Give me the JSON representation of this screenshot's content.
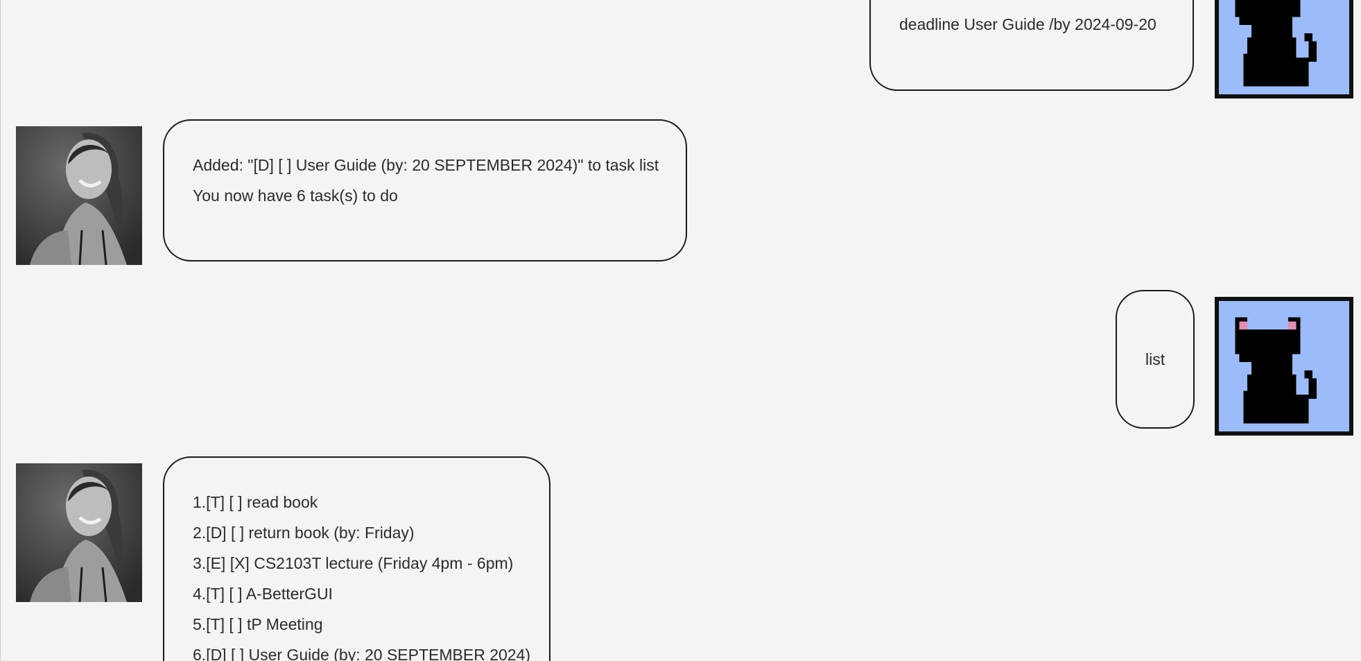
{
  "window": {
    "background": "#f4f4f4"
  },
  "messages": [
    {
      "sender": "user",
      "lines": [
        "deadline User Guide /by 2024-09-20"
      ]
    },
    {
      "sender": "bot",
      "lines": [
        "Added: \"[D] [ ] User Guide (by: 20 SEPTEMBER 2024)\" to task list",
        "You now have 6 task(s) to do"
      ]
    },
    {
      "sender": "user",
      "lines": [
        "list"
      ]
    },
    {
      "sender": "bot",
      "lines": [
        "1.[T] [ ] read book",
        "2.[D] [ ] return book (by: Friday)",
        "3.[E] [X] CS2103T lecture (Friday 4pm - 6pm)",
        "4.[T] [ ] A-BetterGUI",
        "5.[T] [ ] tP Meeting",
        "6.[D] [ ] User Guide (by: 20 SEPTEMBER 2024)"
      ]
    }
  ],
  "avatars": {
    "bot": {
      "icon": "woman-portrait-photo"
    },
    "user": {
      "icon": "black-cat-pixel-icon",
      "background": "#9bbcf8",
      "ear_color": "#e58fb5"
    }
  }
}
